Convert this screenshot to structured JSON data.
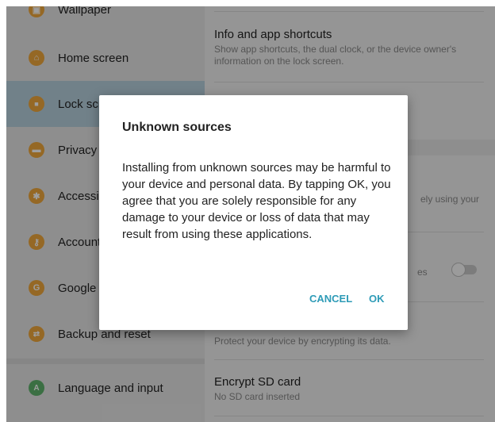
{
  "sidebar": {
    "items": [
      {
        "label": "Wallpaper",
        "icon": "wallpaper-icon",
        "color": "#f0a83c",
        "glyph": "▣"
      },
      {
        "label": "Home screen",
        "icon": "home-icon",
        "color": "#f0a83c",
        "glyph": "⌂"
      },
      {
        "label": "Lock screen",
        "icon": "lock-icon",
        "color": "#f0a83c",
        "glyph": "🔒"
      },
      {
        "label": "Privacy",
        "icon": "privacy-icon",
        "color": "#f0a83c",
        "glyph": "▬"
      },
      {
        "label": "Accessibility",
        "icon": "accessibility-icon",
        "color": "#f0a83c",
        "glyph": "✱"
      },
      {
        "label": "Accounts",
        "icon": "key-icon",
        "color": "#f0a83c",
        "glyph": "⚷"
      },
      {
        "label": "Google",
        "icon": "google-icon",
        "color": "#f0a83c",
        "glyph": "G"
      },
      {
        "label": "Backup and reset",
        "icon": "backup-icon",
        "color": "#f0a83c",
        "glyph": "⇄"
      },
      {
        "label": "Language and input",
        "icon": "language-icon",
        "color": "#5fb46c",
        "glyph": "A"
      }
    ],
    "active_index": 2
  },
  "main": {
    "info_shortcuts": {
      "title": "Info and app shortcuts",
      "subtitle": "Show app shortcuts, the dual clock, or the device owner's information on the lock screen."
    },
    "partial_sub_1": "ely using your",
    "partial_sub_2": "es",
    "encrypt_device_sub": "Protect your device by encrypting its data.",
    "encrypt_sd": {
      "title": "Encrypt SD card",
      "subtitle": "No SD card inserted"
    }
  },
  "dialog": {
    "title": "Unknown sources",
    "message": "Installing from unknown sources may be harmful to your device and personal data. By tapping OK, you agree that you are solely responsible for any damage to your device or loss of data that may result from using these applications.",
    "cancel_label": "CANCEL",
    "ok_label": "OK"
  },
  "colors": {
    "accent": "#2e9bb7",
    "active_sidebar": "#b7d1de"
  }
}
